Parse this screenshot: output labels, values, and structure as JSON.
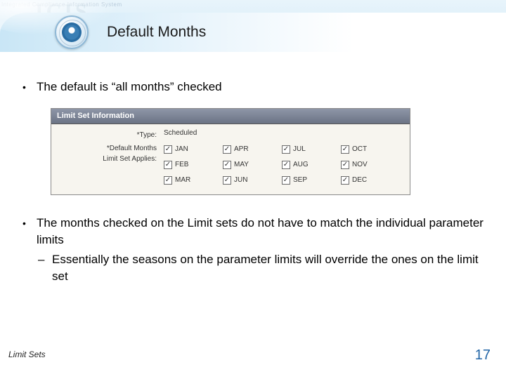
{
  "header": {
    "watermark_big": "ICIS",
    "watermark_small": "Integrated Compliance Information System",
    "title": "Default Months"
  },
  "bullets": {
    "b1": "The default is “all months” checked",
    "b2": "The months checked on the Limit sets do not have to match the individual parameter limits",
    "b2_sub1": "Essentially the seasons on the parameter limits will override the ones on the limit set"
  },
  "screenshot": {
    "panel_title": "Limit Set Information",
    "label_type_prefix": "*",
    "label_type": "Type:",
    "type_value": "Scheduled",
    "label_months_prefix": "*",
    "label_months_line1": "Default Months",
    "label_months_line2": "Limit Set Applies:",
    "check_glyph": "✓",
    "months": {
      "m0": "JAN",
      "m1": "APR",
      "m2": "JUL",
      "m3": "OCT",
      "m4": "FEB",
      "m5": "MAY",
      "m6": "AUG",
      "m7": "NOV",
      "m8": "MAR",
      "m9": "JUN",
      "m10": "SEP",
      "m11": "DEC"
    }
  },
  "footer": {
    "section": "Limit Sets",
    "page": "17"
  }
}
